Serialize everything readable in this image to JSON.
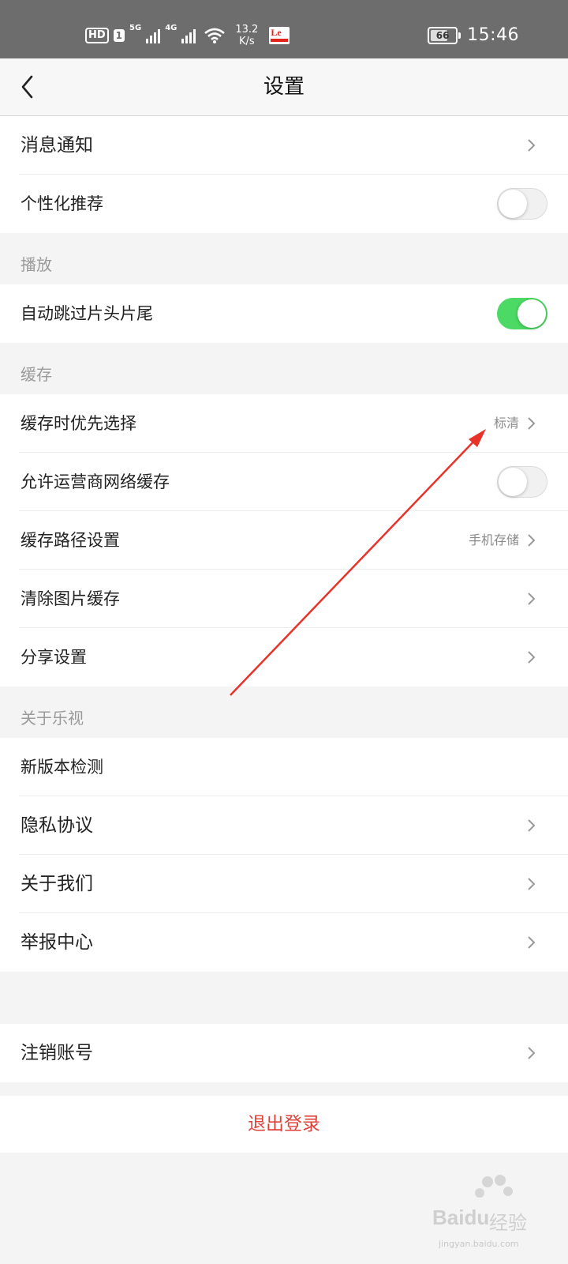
{
  "status_bar": {
    "hd": "HD",
    "sim": "1",
    "net1": "5G",
    "net2": "4G",
    "speed_value": "13.2",
    "speed_unit": "K/s",
    "app_badge": "Le",
    "battery_level": "66",
    "time": "15:46"
  },
  "nav": {
    "title": "设置",
    "back_icon": "chevron-left-icon"
  },
  "group1": {
    "items": [
      {
        "label": "消息通知"
      },
      {
        "label": "个性化推荐",
        "toggle": false
      }
    ]
  },
  "section_play": {
    "header": "播放",
    "items": [
      {
        "label": "自动跳过片头片尾",
        "toggle": true
      }
    ]
  },
  "section_cache": {
    "header": "缓存",
    "items": [
      {
        "label": "缓存时优先选择",
        "value": "标清"
      },
      {
        "label": "允许运营商网络缓存",
        "toggle": false
      },
      {
        "label": "缓存路径设置",
        "value": "手机存储"
      },
      {
        "label": "清除图片缓存"
      },
      {
        "label": "分享设置"
      }
    ]
  },
  "section_about": {
    "header": "关于乐视",
    "items": [
      {
        "label": "新版本检测"
      },
      {
        "label": "隐私协议"
      },
      {
        "label": "关于我们"
      },
      {
        "label": "举报中心"
      }
    ]
  },
  "account": {
    "items": [
      {
        "label": "注销账号"
      }
    ]
  },
  "logout_label": "退出登录",
  "colors": {
    "toggle_on": "#4cd964",
    "logout": "#e0423a",
    "annotation_arrow": "#e8332a"
  },
  "watermark": {
    "brand": "Baidu",
    "brand_cn": "经验",
    "url": "jingyan.baidu.com"
  }
}
